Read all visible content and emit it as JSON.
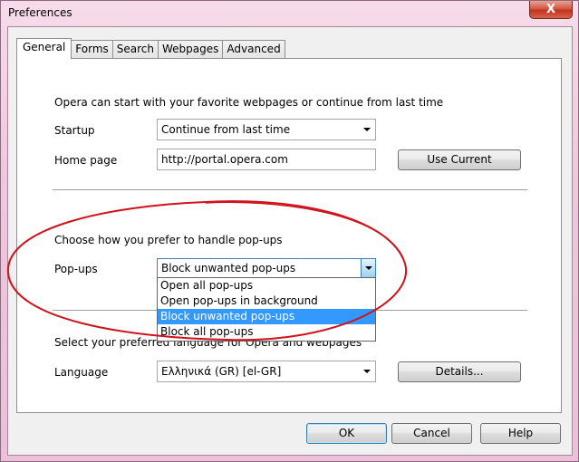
{
  "window": {
    "title": "Preferences",
    "close_glyph": "X"
  },
  "tabs": [
    {
      "label": "General",
      "active": true
    },
    {
      "label": "Forms"
    },
    {
      "label": "Search"
    },
    {
      "label": "Webpages"
    },
    {
      "label": "Advanced"
    }
  ],
  "startup_section": {
    "intro": "Opera can start with your favorite webpages or continue from last time",
    "startup_label": "Startup",
    "startup_value": "Continue from last time",
    "homepage_label": "Home page",
    "homepage_value": "http://portal.opera.com",
    "use_current_label": "Use Current"
  },
  "popups_section": {
    "intro": "Choose how you prefer to handle pop-ups",
    "popups_label": "Pop-ups",
    "popups_value": "Block unwanted pop-ups",
    "options": [
      "Open all pop-ups",
      "Open pop-ups in background",
      "Block unwanted pop-ups",
      "Block all pop-ups"
    ],
    "selected_index": 2
  },
  "language_section": {
    "intro": "Select your preferred language for Opera and webpages",
    "language_label": "Language",
    "language_value": "Ελληνικά (GR) [el-GR]",
    "details_label": "Details..."
  },
  "footer": {
    "ok_label": "OK",
    "cancel_label": "Cancel",
    "help_label": "Help"
  },
  "colors": {
    "highlight": "#3399ff",
    "annotation": "#d0121b"
  }
}
